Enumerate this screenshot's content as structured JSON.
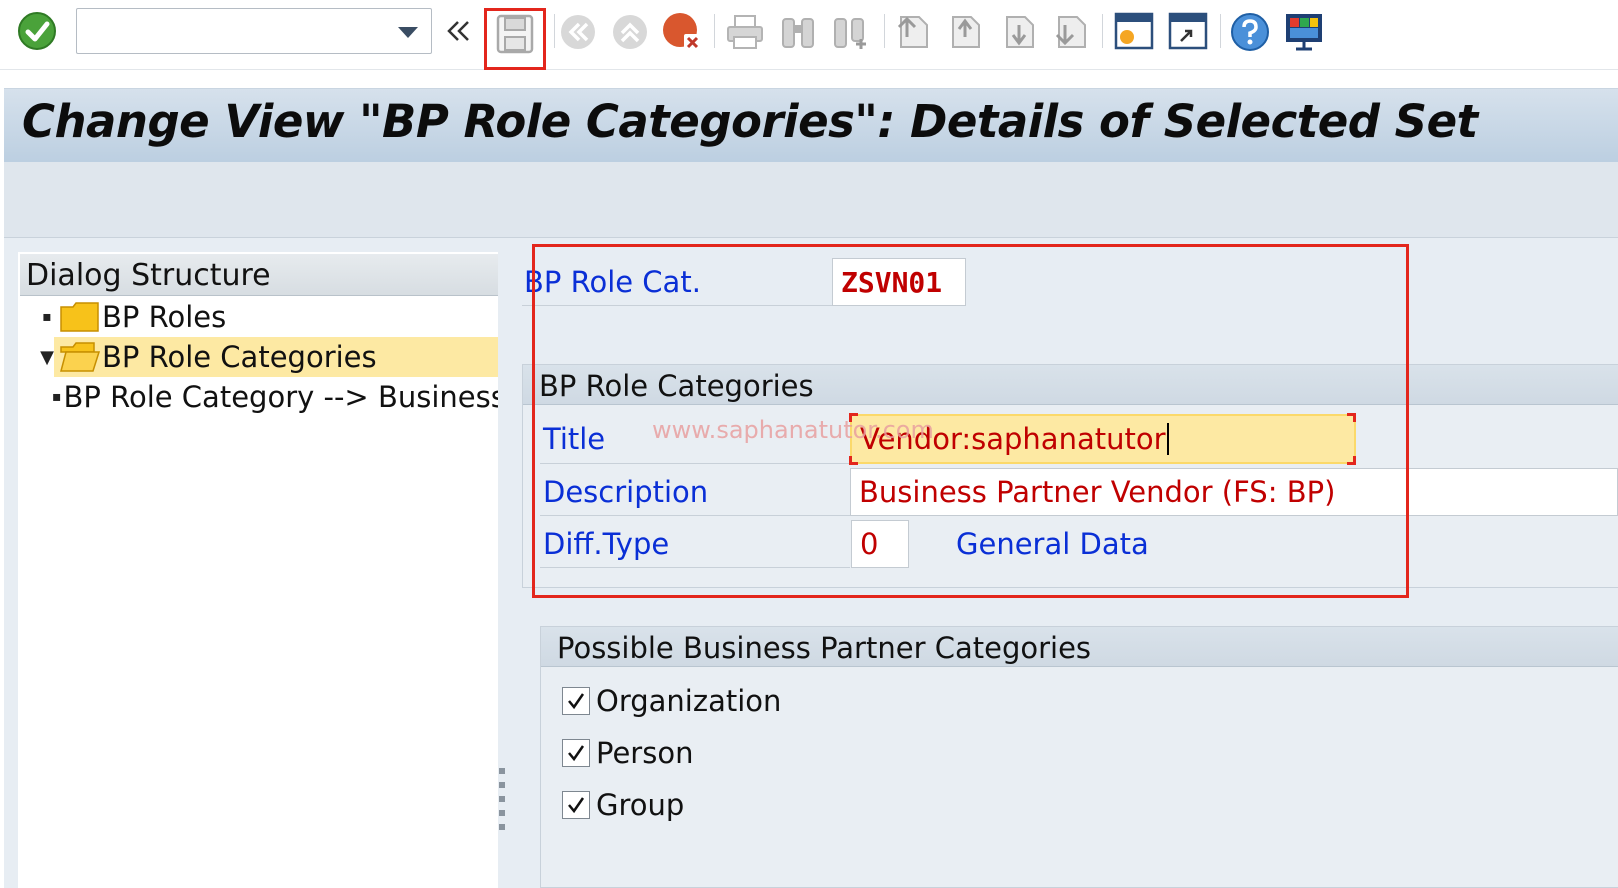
{
  "toolbar": {
    "command_field_value": "",
    "icons": [
      "enter-icon",
      "dropdown-icon",
      "collapse-icon",
      "save-icon",
      "back-icon",
      "exit-icon",
      "cancel-icon",
      "print-icon",
      "find-icon",
      "find-next-icon",
      "first-page-icon",
      "previous-page-icon",
      "next-page-icon",
      "last-page-icon",
      "create-session-icon",
      "shortcut-icon",
      "help-icon",
      "layout-icon"
    ]
  },
  "title": "Change View \"BP Role Categories\": Details of Selected Set",
  "dialog_structure": {
    "header": "Dialog Structure",
    "items": [
      {
        "label": "BP Roles"
      },
      {
        "label": "BP Role Categories"
      },
      {
        "label": "BP Role Category --> Business Transaction"
      }
    ]
  },
  "details": {
    "bp_role_cat_label": "BP Role Cat.",
    "bp_role_cat_value": "ZSVN01",
    "group_title": "BP Role Categories",
    "title_label": "Title",
    "title_value": "Vendor:saphanatutor",
    "description_label": "Description",
    "description_value": "Business Partner Vendor (FS: BP)",
    "diff_type_label": "Diff.Type",
    "diff_type_value": "0",
    "diff_type_text": "General Data"
  },
  "possible_categories": {
    "title": "Possible Business Partner Categories",
    "items": [
      {
        "label": "Organization",
        "checked": true
      },
      {
        "label": "Person",
        "checked": true
      },
      {
        "label": "Group",
        "checked": true
      }
    ]
  },
  "watermark": "www.saphanatutor.com",
  "colors": {
    "highlight": "#e3261c",
    "label_blue": "#0a2fd6",
    "value_red": "#c00000",
    "selection": "#fde9a3"
  }
}
